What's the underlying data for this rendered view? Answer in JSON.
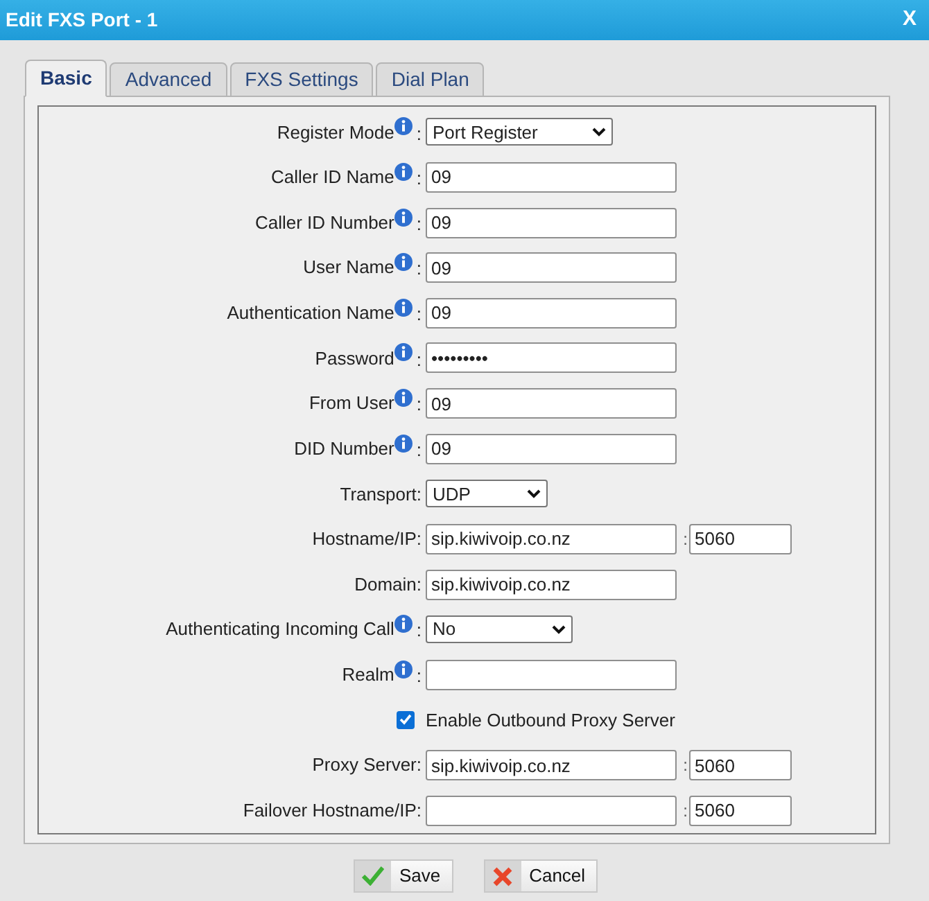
{
  "window": {
    "title": "Edit FXS Port - 1",
    "close": "X"
  },
  "tabs": [
    {
      "label": "Basic",
      "selected": true
    },
    {
      "label": "Advanced",
      "selected": false
    },
    {
      "label": "FXS Settings",
      "selected": false
    },
    {
      "label": "Dial Plan",
      "selected": false
    }
  ],
  "fields": [
    {
      "kind": "select",
      "label": "Register Mode",
      "info": true,
      "colon": ":",
      "value": "Port Register"
    },
    {
      "kind": "text",
      "label": "Caller ID Name",
      "info": true,
      "colon": ":",
      "value": "09"
    },
    {
      "kind": "text",
      "label": "Caller ID Number",
      "info": true,
      "colon": ":",
      "value": "09"
    },
    {
      "kind": "text",
      "label": "User Name",
      "info": true,
      "colon": ":",
      "value": "09"
    },
    {
      "kind": "text",
      "label": "Authentication Name",
      "info": true,
      "colon": ":",
      "value": "09"
    },
    {
      "kind": "password",
      "label": "Password",
      "info": true,
      "colon": ":",
      "value": "•••••••••"
    },
    {
      "kind": "text",
      "label": "From User",
      "info": true,
      "colon": ":",
      "value": "09"
    },
    {
      "kind": "text",
      "label": "DID Number",
      "info": true,
      "colon": ":",
      "value": "09"
    },
    {
      "kind": "select",
      "label": "Transport:",
      "info": false,
      "value": "UDP"
    },
    {
      "kind": "text",
      "label": "Hostname/IP:",
      "info": false,
      "value": "sip.kiwivoip.co.nz",
      "port_separator": ":",
      "port": "5060"
    },
    {
      "kind": "text",
      "label": "Domain:",
      "info": false,
      "value": "sip.kiwivoip.co.nz"
    },
    {
      "kind": "select",
      "label": "Authenticating Incoming Call",
      "info": true,
      "colon": ":",
      "value": "No"
    },
    {
      "kind": "text",
      "label": "Realm",
      "info": true,
      "colon": ":"
    },
    {
      "kind": "checkbox",
      "label": "Enable Outbound Proxy Server",
      "checked": true
    },
    {
      "kind": "text",
      "label": "Proxy Server:",
      "info": false,
      "value": "sip.kiwivoip.co.nz",
      "port_separator": ":",
      "port": "5060"
    },
    {
      "kind": "text",
      "label": "Failover Hostname/IP:",
      "info": false,
      "port_separator": ":",
      "port": "5060"
    }
  ],
  "buttons": [
    {
      "kind": "save",
      "label": "Save"
    },
    {
      "kind": "cancel",
      "label": "Cancel"
    }
  ]
}
